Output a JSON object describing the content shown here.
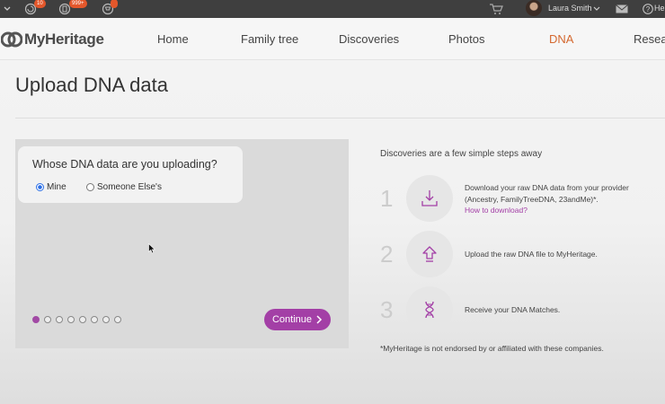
{
  "topbar": {
    "sync_badge": "10",
    "tree_badge": "999+",
    "user_name": "Laura Smith",
    "help_label": "He"
  },
  "logo": {
    "text": "MyHeritage"
  },
  "nav": {
    "items": [
      "Home",
      "Family tree",
      "Discoveries",
      "Photos",
      "DNA",
      "Resea"
    ],
    "active": "DNA",
    "active_color": "#d4682f"
  },
  "page": {
    "title": "Upload DNA data"
  },
  "upload": {
    "question": "Whose DNA data are you uploading?",
    "options": [
      "Mine",
      "Someone Else's"
    ],
    "selected": "Mine",
    "steps_total": 8,
    "current_step": 1,
    "continue_label": "Continue",
    "accent_color": "#a33fa6"
  },
  "steps": {
    "heading": "Discoveries are a few simple steps away",
    "items": [
      {
        "number": "1",
        "icon": "download-icon",
        "line1": "Download your raw DNA data from your provider",
        "line2": "(Ancestry, FamilyTreeDNA, 23andMe)*.",
        "link": "How to download?"
      },
      {
        "number": "2",
        "icon": "upload-icon",
        "line1": "Upload the raw DNA file to MyHeritage.",
        "line2": "",
        "link": ""
      },
      {
        "number": "3",
        "icon": "dna-icon",
        "line1": "Receive your DNA Matches.",
        "line2": "",
        "link": ""
      }
    ],
    "disclaimer": "*MyHeritage is not endorsed by or affiliated with these companies."
  }
}
